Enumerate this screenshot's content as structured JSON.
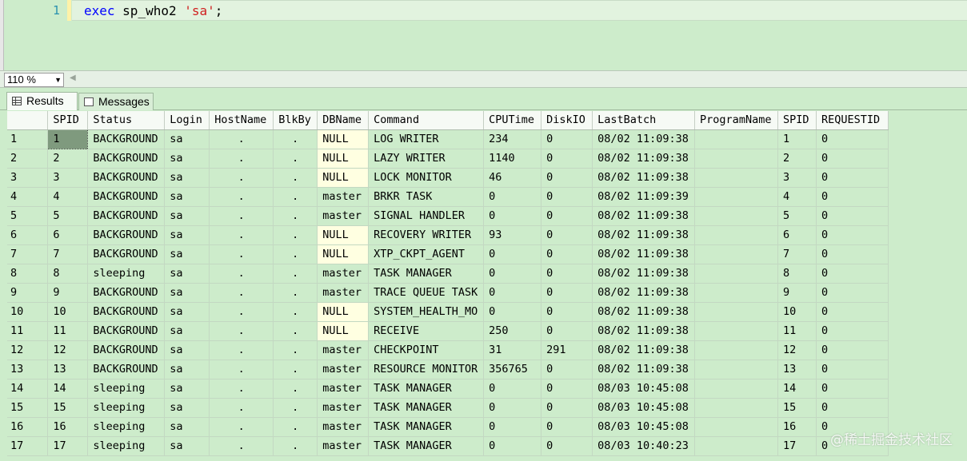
{
  "editor": {
    "line_number": "1",
    "code": {
      "kw": "exec",
      "proc": "sp_who2",
      "arg": "'sa'",
      "end": ";"
    }
  },
  "zoom": {
    "value": "110 %"
  },
  "tabs": [
    {
      "label": "Results",
      "icon": "grid-icon"
    },
    {
      "label": "Messages",
      "icon": "messages-icon"
    }
  ],
  "grid": {
    "columns": [
      "",
      "SPID",
      "Status",
      "Login",
      "HostName",
      "BlkBy",
      "DBName",
      "Command",
      "CPUTime",
      "DiskIO",
      "LastBatch",
      "ProgramName",
      "SPID",
      "REQUESTID"
    ],
    "rows": [
      [
        "1",
        "1",
        "BACKGROUND",
        "sa",
        ".",
        ".",
        "NULL",
        "LOG WRITER",
        "234",
        "0",
        "08/02 11:09:38",
        "",
        "1",
        "0"
      ],
      [
        "2",
        "2",
        "BACKGROUND",
        "sa",
        ".",
        ".",
        "NULL",
        "LAZY WRITER",
        "1140",
        "0",
        "08/02 11:09:38",
        "",
        "2",
        "0"
      ],
      [
        "3",
        "3",
        "BACKGROUND",
        "sa",
        ".",
        ".",
        "NULL",
        "LOCK MONITOR",
        "46",
        "0",
        "08/02 11:09:38",
        "",
        "3",
        "0"
      ],
      [
        "4",
        "4",
        "BACKGROUND",
        "sa",
        ".",
        ".",
        "master",
        "BRKR TASK",
        "0",
        "0",
        "08/02 11:09:39",
        "",
        "4",
        "0"
      ],
      [
        "5",
        "5",
        "BACKGROUND",
        "sa",
        ".",
        ".",
        "master",
        "SIGNAL HANDLER",
        "0",
        "0",
        "08/02 11:09:38",
        "",
        "5",
        "0"
      ],
      [
        "6",
        "6",
        "BACKGROUND",
        "sa",
        ".",
        ".",
        "NULL",
        "RECOVERY WRITER",
        "93",
        "0",
        "08/02 11:09:38",
        "",
        "6",
        "0"
      ],
      [
        "7",
        "7",
        "BACKGROUND",
        "sa",
        ".",
        ".",
        "NULL",
        "XTP_CKPT_AGENT",
        "0",
        "0",
        "08/02 11:09:38",
        "",
        "7",
        "0"
      ],
      [
        "8",
        "8",
        "sleeping",
        "sa",
        ".",
        ".",
        "master",
        "TASK MANAGER",
        "0",
        "0",
        "08/02 11:09:38",
        "",
        "8",
        "0"
      ],
      [
        "9",
        "9",
        "BACKGROUND",
        "sa",
        ".",
        ".",
        "master",
        "TRACE QUEUE TASK",
        "0",
        "0",
        "08/02 11:09:38",
        "",
        "9",
        "0"
      ],
      [
        "10",
        "10",
        "BACKGROUND",
        "sa",
        ".",
        ".",
        "NULL",
        "SYSTEM_HEALTH_MO",
        "0",
        "0",
        "08/02 11:09:38",
        "",
        "10",
        "0"
      ],
      [
        "11",
        "11",
        "BACKGROUND",
        "sa",
        ".",
        ".",
        "NULL",
        "RECEIVE",
        "250",
        "0",
        "08/02 11:09:38",
        "",
        "11",
        "0"
      ],
      [
        "12",
        "12",
        "BACKGROUND",
        "sa",
        ".",
        ".",
        "master",
        "CHECKPOINT",
        "31",
        "291",
        "08/02 11:09:38",
        "",
        "12",
        "0"
      ],
      [
        "13",
        "13",
        "BACKGROUND",
        "sa",
        ".",
        ".",
        "master",
        "RESOURCE MONITOR",
        "356765",
        "0",
        "08/02 11:09:38",
        "",
        "13",
        "0"
      ],
      [
        "14",
        "14",
        "sleeping",
        "sa",
        ".",
        ".",
        "master",
        "TASK MANAGER",
        "0",
        "0",
        "08/03 10:45:08",
        "",
        "14",
        "0"
      ],
      [
        "15",
        "15",
        "sleeping",
        "sa",
        ".",
        ".",
        "master",
        "TASK MANAGER",
        "0",
        "0",
        "08/03 10:45:08",
        "",
        "15",
        "0"
      ],
      [
        "16",
        "16",
        "sleeping",
        "sa",
        ".",
        ".",
        "master",
        "TASK MANAGER",
        "0",
        "0",
        "08/03 10:45:08",
        "",
        "16",
        "0"
      ],
      [
        "17",
        "17",
        "sleeping",
        "sa",
        ".",
        ".",
        "master",
        "TASK MANAGER",
        "0",
        "0",
        "08/03 10:40:23",
        "",
        "17",
        "0"
      ]
    ]
  },
  "watermark": "@稀土掘金技术社区",
  "colors": {
    "background": "#cdeccb",
    "null_cell": "#ffffe1",
    "keyword": "#0000ff",
    "string": "#d01f1f"
  }
}
